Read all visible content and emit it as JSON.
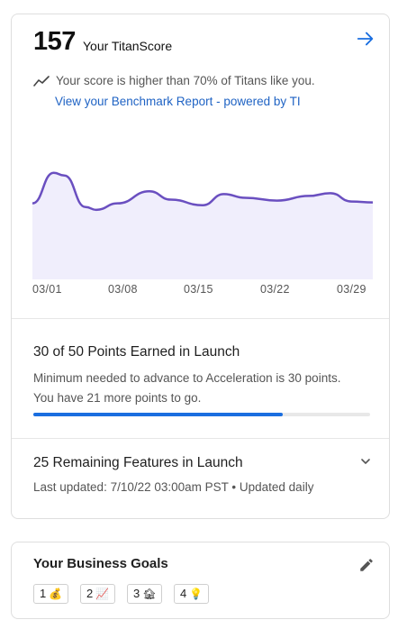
{
  "score": {
    "value": "157",
    "label": "Your TitanScore",
    "comparison": "Your score is higher than 70% of Titans like you.",
    "benchmark_link": "View your Benchmark Report - powered by TI"
  },
  "chart_data": {
    "type": "area",
    "x_ticks": [
      "03/01",
      "03/08",
      "03/15",
      "03/22",
      "03/29"
    ],
    "points": [
      {
        "x": 0,
        "y": 82
      },
      {
        "x": 2,
        "y": 115
      },
      {
        "x": 3,
        "y": 112
      },
      {
        "x": 5,
        "y": 78
      },
      {
        "x": 6,
        "y": 75
      },
      {
        "x": 8,
        "y": 82
      },
      {
        "x": 11,
        "y": 95
      },
      {
        "x": 13,
        "y": 86
      },
      {
        "x": 16,
        "y": 80
      },
      {
        "x": 18,
        "y": 92
      },
      {
        "x": 20,
        "y": 88
      },
      {
        "x": 23,
        "y": 85
      },
      {
        "x": 26,
        "y": 90
      },
      {
        "x": 28,
        "y": 93
      },
      {
        "x": 30,
        "y": 84
      },
      {
        "x": 32,
        "y": 83
      }
    ],
    "ylim": [
      0,
      140
    ],
    "xlim": [
      0,
      32
    ],
    "line_color": "#6a4fc0",
    "fill_color": "#f0eefc",
    "grid": false,
    "legend": "none"
  },
  "points": {
    "title": "30 of 50 Points Earned in Launch",
    "desc_line1": "Minimum needed to advance to Acceleration is 30 points.",
    "desc_line2": "You have 21 more points to go.",
    "progress_fraction": 0.74
  },
  "features": {
    "title": "25 Remaining Features in Launch",
    "updated": "Last updated: 7/10/22 03:00am PST • Updated daily"
  },
  "goals": {
    "title": "Your Business Goals",
    "chips": [
      {
        "num": "1",
        "emoji": "💰"
      },
      {
        "num": "2",
        "emoji": "📈"
      },
      {
        "num": "3",
        "emoji": "🏚"
      },
      {
        "num": "4",
        "emoji": "💡"
      }
    ]
  },
  "colors": {
    "accent": "#1a6ee0",
    "link": "#1f63c4",
    "chart_line": "#6a4fc0",
    "chart_fill": "#f0eefc"
  },
  "icons": {
    "arrow": "arrow-right-icon",
    "trend": "trending-up-icon",
    "chevron": "chevron-down-icon",
    "pencil": "pencil-icon"
  }
}
